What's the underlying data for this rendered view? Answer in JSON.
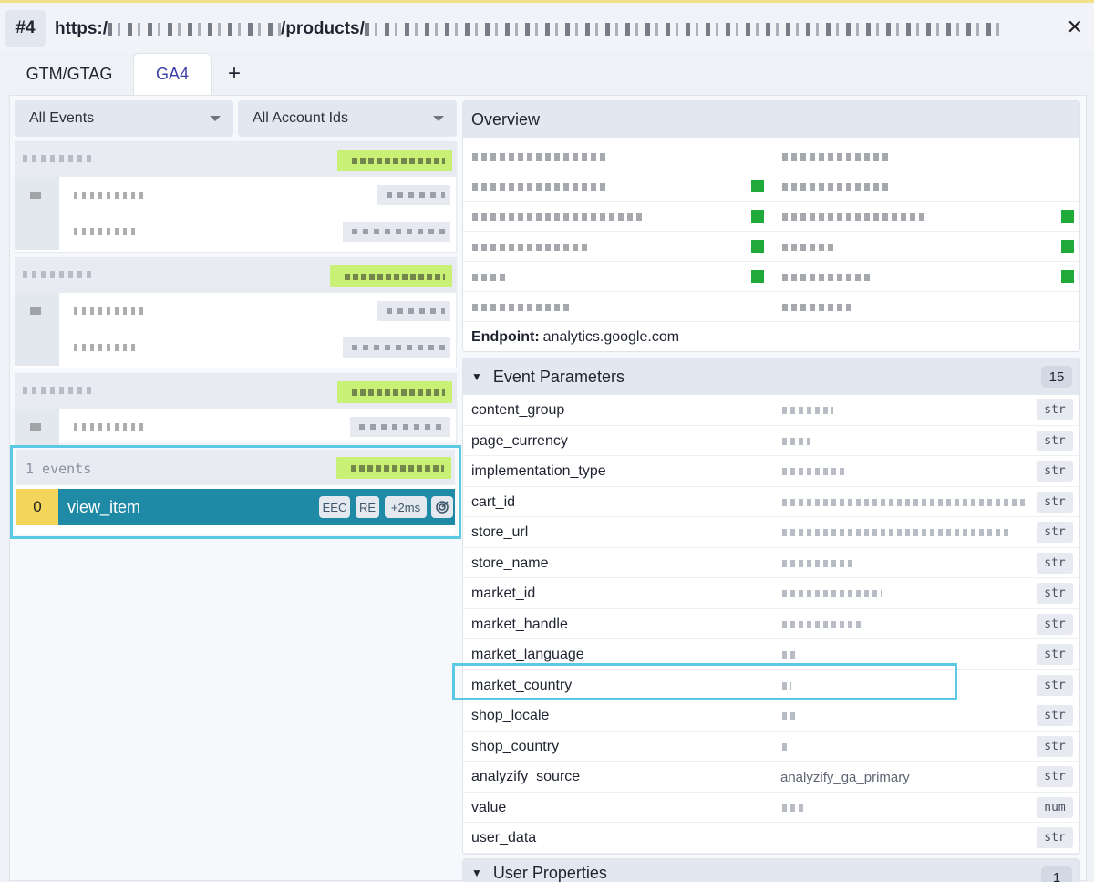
{
  "header": {
    "tab_number": "#4",
    "url_prefix": "https:/",
    "url_path": "/products/",
    "close_glyph": "✕"
  },
  "tabs": [
    {
      "label": "GTM/GTAG"
    },
    {
      "label": "GA4"
    },
    {
      "label": "+"
    }
  ],
  "filters": {
    "events": "All Events",
    "accounts": "All Account Ids"
  },
  "events_list": {
    "group_count_label": "1 events",
    "selected_event": {
      "index": "0",
      "name": "view_item",
      "badges": [
        "EEC",
        "RE",
        "+2ms"
      ],
      "icon": "target-icon"
    }
  },
  "overview": {
    "title": "Overview",
    "endpoint_label": "Endpoint:",
    "endpoint_value": "analytics.google.com"
  },
  "event_parameters": {
    "title": "Event Parameters",
    "count": "15",
    "params": [
      {
        "key": "content_group",
        "type": "str"
      },
      {
        "key": "page_currency",
        "type": "str"
      },
      {
        "key": "implementation_type",
        "type": "str"
      },
      {
        "key": "cart_id",
        "type": "str"
      },
      {
        "key": "store_url",
        "type": "str"
      },
      {
        "key": "store_name",
        "type": "str"
      },
      {
        "key": "market_id",
        "type": "str"
      },
      {
        "key": "market_handle",
        "type": "str"
      },
      {
        "key": "market_language",
        "type": "str"
      },
      {
        "key": "market_country",
        "type": "str"
      },
      {
        "key": "shop_locale",
        "type": "str"
      },
      {
        "key": "shop_country",
        "type": "str"
      },
      {
        "key": "analyzify_source",
        "value": "analyzify_ga_primary",
        "type": "str"
      },
      {
        "key": "value",
        "type": "num"
      },
      {
        "key": "user_data",
        "type": "str"
      }
    ]
  },
  "user_properties": {
    "title": "User Properties",
    "count": "1"
  },
  "colors": {
    "accent_tab": "#3c3ea8",
    "selected_event_bg": "#1f8aa6",
    "event_index_bg": "#f2d55a",
    "highlight_border": "#5bc8e4",
    "green_tag": "#c8f074"
  }
}
